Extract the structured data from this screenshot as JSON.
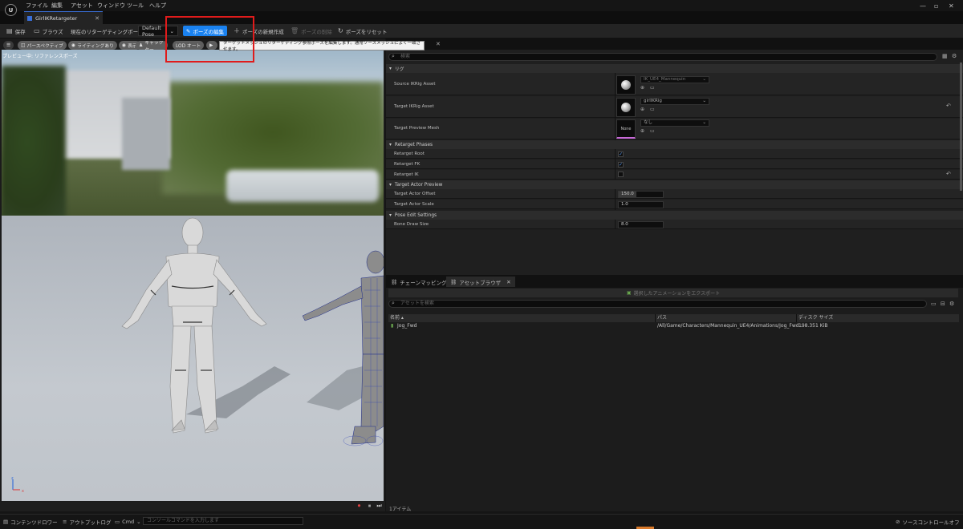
{
  "menubar": {
    "items": [
      "ファイル",
      "編集",
      "アセット",
      "ウィンドウ",
      "ツール",
      "ヘルプ"
    ],
    "logo": "U"
  },
  "tab": {
    "title": "GirlIKRetargeter"
  },
  "toolbar": {
    "save": "保存",
    "browse": "ブラウズ",
    "current_pose_label": "現在のリターゲティングポーズ",
    "pose_value": "Default Pose",
    "edit_pose": "ポーズの編集",
    "new_pose": "ポーズの新規作成",
    "delete_pose": "ポーズの削除",
    "reset_pose": "ポーズをリセット",
    "tooltip": "ターゲットメッシュのリターゲティング参照ポーズを編集します。通常ソースメッシュによく一致させます。"
  },
  "viewport": {
    "pills": [
      "パースペクティブ",
      "ライティングあり",
      "表示",
      "キャラクター",
      "LOD オート"
    ],
    "overlay_label": "プレビュー中: リファレンスポーズ"
  },
  "details": {
    "search_placeholder": "検索",
    "categories": {
      "rig": "リグ",
      "phases": "Retarget Phases",
      "target_preview": "Target Actor Preview",
      "pose_edit": "Pose Edit Settings"
    },
    "rows": {
      "source_rig_label": "Source IKRig Asset",
      "source_rig_value": "IK_UE4_Mannequin",
      "target_rig_label": "Target IKRig Asset",
      "target_rig_value": "girlIKRig",
      "target_mesh_label": "Target Preview Mesh",
      "target_mesh_value": "なし",
      "target_mesh_thumb": "None",
      "retarget_root_label": "Retarget Root",
      "retarget_fk_label": "Retarget FK",
      "retarget_ik_label": "Retarget IK",
      "target_offset_label": "Target Actor Offset",
      "target_offset_value": "150.0",
      "target_scale_label": "Target Actor Scale",
      "target_scale_value": "1.0",
      "bone_draw_label": "Bone Draw Size",
      "bone_draw_value": "8.0"
    }
  },
  "bottom_panel": {
    "tabs": [
      "チェーンマッピング",
      "アセットブラウザ"
    ],
    "export_button": "選択したアニメーションをエクスポート",
    "search_placeholder": "アセットを検索",
    "columns": [
      "名前",
      "パス",
      "ディスク サイズ"
    ],
    "assets": [
      {
        "name": "Jog_Fwd",
        "path": "/All/Game/Characters/Mannequin_UE4/Animations/Jog_Fwd...",
        "size": "198.351 KiB"
      }
    ],
    "item_count": "1アイテム"
  },
  "statusbar": {
    "content_drawer": "コンテンツドロワー",
    "output_log": "アウトプットログ",
    "cmd": "Cmd",
    "cmd_placeholder": "コンソールコマンドを入力します",
    "source_control": "ソースコントロールオフ"
  },
  "colors": {
    "accent": "#1a82f0",
    "highlight": "#e01b1b",
    "checkbox": "#5aa0ff"
  }
}
